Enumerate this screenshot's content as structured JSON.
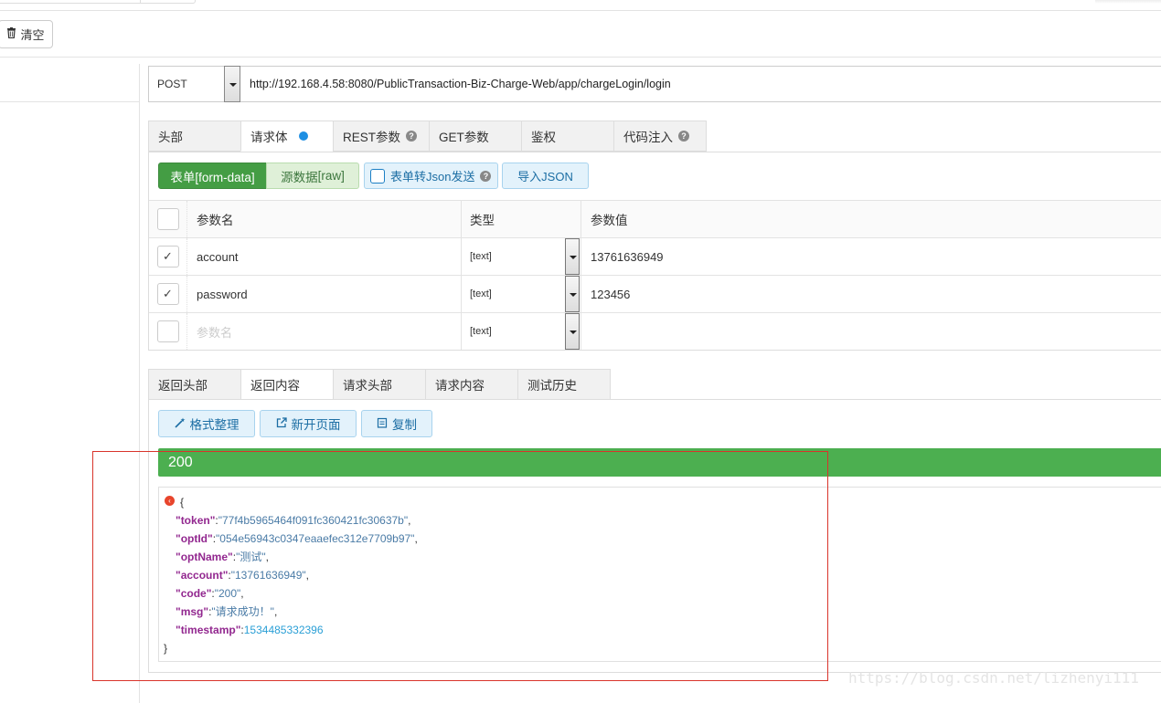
{
  "toolbar": {
    "clear_icon": "trash-icon",
    "clear_label": "清空"
  },
  "request": {
    "method": "POST",
    "url": "http://192.168.4.58:8080/PublicTransaction-Biz-Charge-Web/app/chargeLogin/login"
  },
  "request_tabs": [
    {
      "label": "头部"
    },
    {
      "label": "请求体"
    },
    {
      "label": "REST参数"
    },
    {
      "label": "GET参数"
    },
    {
      "label": "鉴权"
    },
    {
      "label": "代码注入"
    }
  ],
  "body_modes": {
    "form_data": "表单[form-data]",
    "raw_prefix": "源数据",
    "raw_suffix": "[raw]",
    "json_toggle": "表单转Json发送",
    "import_json": "导入JSON"
  },
  "params_table": {
    "headers": {
      "name": "参数名",
      "type": "类型",
      "value": "参数值"
    },
    "rows": [
      {
        "checked": "✓",
        "name": "account",
        "type": "[text]",
        "value": "13761636949"
      },
      {
        "checked": "✓",
        "name": "password",
        "type": "[text]",
        "value": "123456"
      }
    ],
    "empty_row": {
      "name_placeholder": "参数名",
      "type": "[text]"
    }
  },
  "response_tabs": [
    {
      "label": "返回头部"
    },
    {
      "label": "返回内容"
    },
    {
      "label": "请求头部"
    },
    {
      "label": "请求内容"
    },
    {
      "label": "测试历史"
    }
  ],
  "response_actions": {
    "format": "格式整理",
    "new_page": "新开页面",
    "copy": "复制"
  },
  "response": {
    "status": "200",
    "open_brace": "{",
    "close_brace": "}",
    "collapse_glyph": "‹",
    "fields": [
      {
        "key": "\"token\"",
        "value": "\"77f4b5965464f091fc360421fc30637b\"",
        "trail": ","
      },
      {
        "key": "\"optId\"",
        "value": "\"054e56943c0347eaaefec312e7709b97\"",
        "trail": ","
      },
      {
        "key": "\"optName\"",
        "value": "\"测试\"",
        "trail": ","
      },
      {
        "key": "\"account\"",
        "value": "\"13761636949\"",
        "trail": ","
      },
      {
        "key": "\"code\"",
        "value": "\"200\"",
        "trail": ","
      },
      {
        "key": "\"msg\"",
        "value": "\"请求成功！\"",
        "trail": ","
      },
      {
        "key": "\"timestamp\"",
        "value": "1534485332396",
        "trail": ""
      }
    ]
  },
  "watermark": "https://blog.csdn.net/lizhenyi111",
  "colors": {
    "success_green": "#4caf50",
    "primary_green": "#449d44",
    "info_blue": "#1c6ea4",
    "json_key": "#92278f",
    "highlight_red": "#d9342b"
  }
}
